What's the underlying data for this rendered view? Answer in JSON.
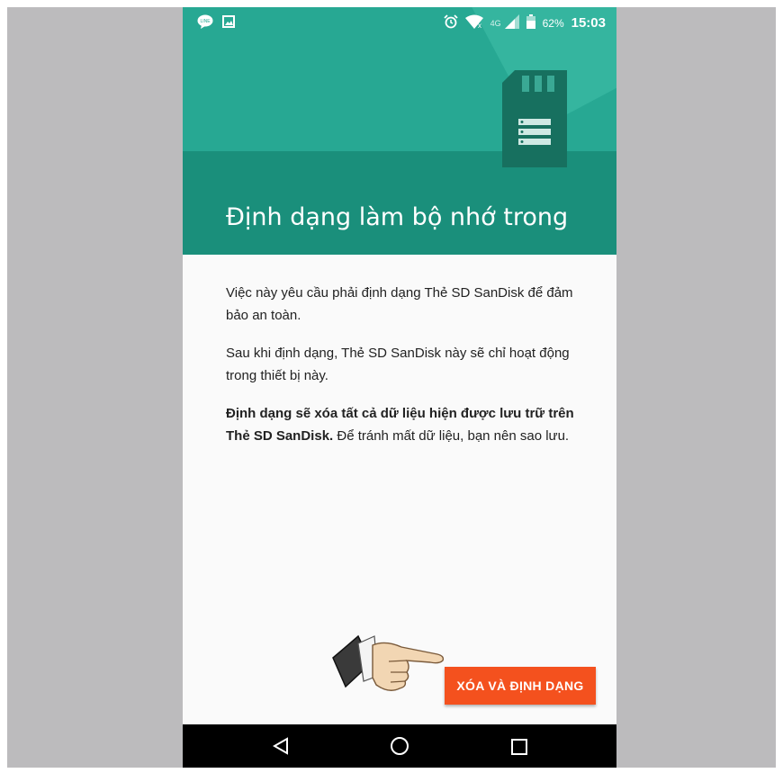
{
  "status_bar": {
    "time": "15:03",
    "battery_percent": "62%",
    "network_label": "4G",
    "left_icons": [
      "chat-app-icon",
      "image-notification-icon"
    ],
    "right_icons": [
      "alarm-icon",
      "wifi-icon",
      "signal-icon",
      "battery-icon"
    ]
  },
  "dialog": {
    "title": "Định dạng làm bộ nhớ trong",
    "paragraph1": "Việc này yêu cầu phải định dạng Thẻ SD SanDisk để đảm bảo an toàn.",
    "paragraph2": "Sau khi định dạng, Thẻ SD SanDisk này sẽ chỉ hoạt động trong thiết bị này.",
    "paragraph3_bold": "Định dạng sẽ xóa tất cả dữ liệu hiện được lưu trữ trên Thẻ SD SanDisk.",
    "paragraph3_rest": " Để tránh mất dữ liệu, bạn nên sao lưu.",
    "action_label": "XÓA VÀ ĐỊNH DẠNG"
  },
  "colors": {
    "header": "#1e9a86",
    "accent_button": "#f4511e",
    "nav_bar": "#000000"
  },
  "nav": [
    "back-icon",
    "home-icon",
    "recents-icon"
  ]
}
